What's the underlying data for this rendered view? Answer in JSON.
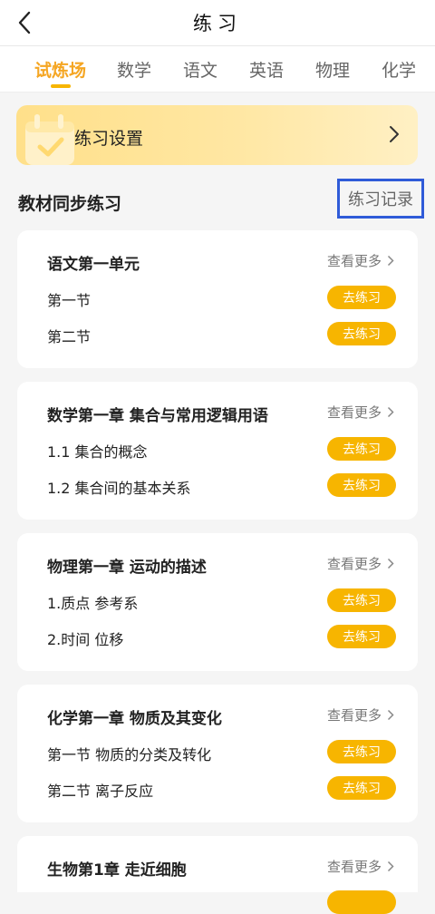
{
  "header": {
    "title": "练习"
  },
  "tabs": [
    {
      "label": "试炼场",
      "active": true
    },
    {
      "label": "数学"
    },
    {
      "label": "语文"
    },
    {
      "label": "英语"
    },
    {
      "label": "物理"
    },
    {
      "label": "化学"
    }
  ],
  "banner": {
    "label": "练习设置"
  },
  "section": {
    "title": "教材同步练习",
    "record_link": "练习记录"
  },
  "more_label": "查看更多",
  "practice_button": "去练习",
  "cards": [
    {
      "title": "语文第一单元",
      "items": [
        "第一节",
        "第二节"
      ]
    },
    {
      "title": "数学第一章 集合与常用逻辑用语",
      "items": [
        "1.1 集合的概念",
        "1.2 集合间的基本关系"
      ]
    },
    {
      "title": "物理第一章 运动的描述",
      "items": [
        "1.质点 参考系",
        "2.时间 位移"
      ]
    },
    {
      "title": "化学第一章 物质及其变化",
      "items": [
        "第一节 物质的分类及转化",
        "第二节 离子反应"
      ]
    },
    {
      "title": "生物第1章 走近细胞",
      "items": []
    }
  ],
  "colors": {
    "accent": "#f7b500",
    "highlight_box": "#2f5bd8"
  }
}
